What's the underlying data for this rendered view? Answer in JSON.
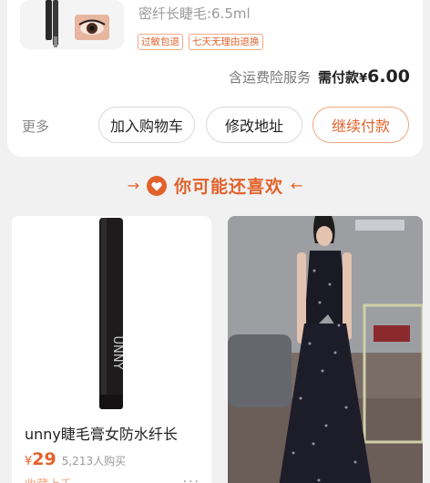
{
  "order": {
    "spec": "密纤长睫毛:6.5ml",
    "tags": [
      "过敏包退",
      "七天无理由退换"
    ],
    "insurance_text": "含运费险服务",
    "pay_label": "需付款",
    "currency": "¥",
    "amount": "6.00",
    "more_label": "更多",
    "buttons": {
      "add_to_cart": "加入购物车",
      "change_address": "修改地址",
      "continue_pay": "继续付款"
    }
  },
  "recommend": {
    "title": "你可能还喜欢",
    "left_arrow": "→",
    "right_arrow": "←",
    "heart_icon": "heart-icon"
  },
  "products": [
    {
      "name": "unny睫毛膏女防水纤长",
      "currency": "¥",
      "price": "29",
      "buyers": "5,213人购买",
      "fav": "收藏上千",
      "more": "···",
      "brand_on_tube": "UNNY"
    },
    {
      "image": "black floral slip dress"
    }
  ],
  "colors": {
    "accent": "#e2622b",
    "background": "#f1f1f1"
  }
}
